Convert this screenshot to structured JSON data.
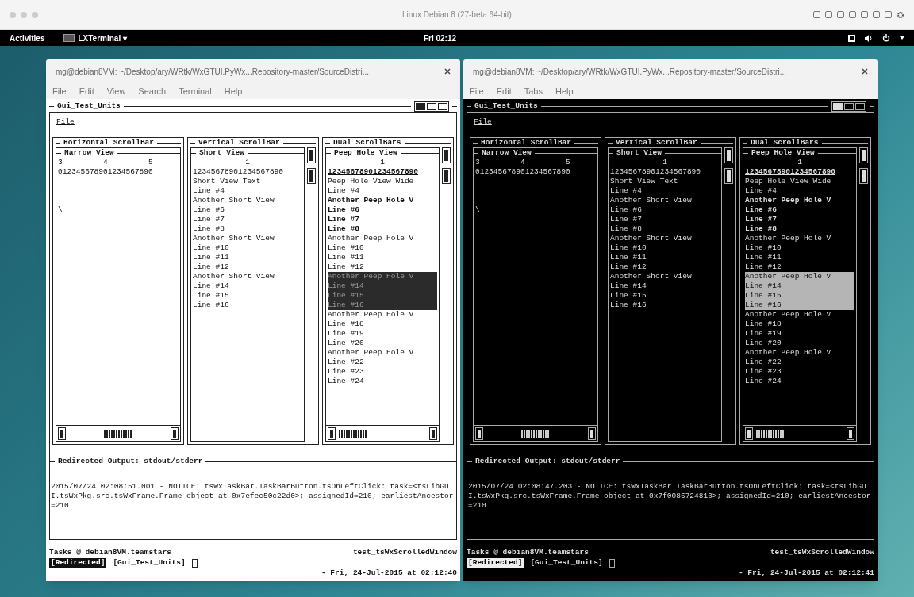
{
  "host_window": {
    "title": "Linux Debian 8 (27-beta 64-bit)"
  },
  "top_bar": {
    "activities": "Activities",
    "app": "LXTerminal ▾",
    "clock": "Fri 02:12"
  },
  "terminals": [
    {
      "kind": "light",
      "title": "mg@debian8VM: ~/Desktop/ary/WRtk/WxGTUI.PyWx...Repository-master/SourceDistri...",
      "menu": [
        "File",
        "Edit",
        "View",
        "Search",
        "Terminal",
        "Help"
      ],
      "app": {
        "title": "Gui_Test_Units",
        "menu": "File",
        "panels": [
          {
            "kind": "horizontal",
            "title": "Horizontal ScrollBar",
            "view_title": "Narrow View",
            "lines": [
              "3         4         5",
              "012345678901234567890"
            ],
            "marker": "\\"
          },
          {
            "kind": "vertical",
            "title": "Vertical ScrollBar",
            "view_title": "Short View",
            "ruler": "1",
            "lines": [
              "12345678901234567890",
              "Short View Text",
              "Line #4",
              "Another Short View",
              "Line #6",
              "Line #7",
              "Line #8",
              "Another Short View",
              "Line #10",
              "Line #11",
              "Line #12",
              "Another Short View",
              "Line #14",
              "Line #15",
              "Line #16"
            ]
          },
          {
            "kind": "dual",
            "title": "Dual ScrollBars",
            "view_title": "Peep Hole View",
            "ruler": "1",
            "lines": [
              {
                "text": "12345678901234567890",
                "bold": true,
                "selected": false
              },
              {
                "text": "Peep Hole View Wide",
                "bold": false,
                "selected": false
              },
              {
                "text": "Line #4",
                "bold": false,
                "selected": false
              },
              {
                "text": "Another Peep Hole V",
                "bold": true,
                "selected": false
              },
              {
                "text": "Line #6",
                "bold": true,
                "selected": false
              },
              {
                "text": "Line #7",
                "bold": true,
                "selected": false
              },
              {
                "text": "Line #8",
                "bold": true,
                "selected": false
              },
              {
                "text": "Another Peep Hole V",
                "bold": false,
                "selected": false
              },
              {
                "text": "Line #10",
                "bold": false,
                "selected": false
              },
              {
                "text": "Line #11",
                "bold": false,
                "selected": false
              },
              {
                "text": "Line #12",
                "bold": false,
                "selected": false
              },
              {
                "text": "Another Peep Hole V",
                "bold": false,
                "selected": true
              },
              {
                "text": "Line #14",
                "bold": false,
                "selected": true
              },
              {
                "text": "Line #15",
                "bold": false,
                "selected": true
              },
              {
                "text": "Line #16",
                "bold": false,
                "selected": true
              },
              {
                "text": "Another Peep Hole V",
                "bold": false,
                "selected": false
              },
              {
                "text": "Line #18",
                "bold": false,
                "selected": false
              },
              {
                "text": "Line #19",
                "bold": false,
                "selected": false
              },
              {
                "text": "Line #20",
                "bold": false,
                "selected": false
              },
              {
                "text": "Another Peep Hole V",
                "bold": false,
                "selected": false
              },
              {
                "text": "Line #22",
                "bold": false,
                "selected": false
              },
              {
                "text": "Line #23",
                "bold": false,
                "selected": false
              },
              {
                "text": "Line #24",
                "bold": false,
                "selected": false
              }
            ]
          }
        ]
      },
      "output": {
        "title": "Redirected Output: stdout/stderr",
        "log": "2015/07/24 02:08:51.001 - NOTICE: tsWxTaskBar.TaskBarButton.tsOnLeftClick: task=<tsLibGUI.tsWxPkg.src.tsWxFrame.Frame object at 0x7efec50c22d0>; assignedId=210; earliestAncestor=210"
      },
      "taskbar": {
        "title": "Tasks @ debian8VM.teamstars",
        "app_name": "test_tsWxScrolledWindow",
        "buttons": [
          {
            "label": "[Redirected]",
            "selected": true
          },
          {
            "label": "[Gui_Test_Units]",
            "selected": false
          }
        ],
        "date": "- Fri, 24-Jul-2015 at 02:12:40"
      }
    },
    {
      "kind": "dark",
      "title": "mg@debian8VM: ~/Desktop/ary/WRtk/WxGTUI.PyWx...Repository-master/SourceDistri...",
      "menu": [
        "File",
        "Edit",
        "Tabs",
        "Help"
      ],
      "app": {
        "title": "Gui_Test_Units",
        "menu": "File",
        "panels": [
          {
            "kind": "horizontal",
            "title": "Horizontal ScrollBar",
            "view_title": "Narrow View",
            "lines": [
              "3         4         5",
              "012345678901234567890"
            ],
            "marker": "\\"
          },
          {
            "kind": "vertical",
            "title": "Vertical ScrollBar",
            "view_title": "Short View",
            "ruler": "1",
            "lines": [
              "12345678901234567890",
              "Short View Text",
              "Line #4",
              "Another Short View",
              "Line #6",
              "Line #7",
              "Line #8",
              "Another Short View",
              "Line #10",
              "Line #11",
              "Line #12",
              "Another Short View",
              "Line #14",
              "Line #15",
              "Line #16"
            ]
          },
          {
            "kind": "dual",
            "title": "Dual ScrollBars",
            "view_title": "Peep Hole View",
            "ruler": "1",
            "lines": [
              {
                "text": "12345678901234567890",
                "bold": true,
                "selected": false
              },
              {
                "text": "Peep Hole View Wide",
                "bold": false,
                "selected": false
              },
              {
                "text": "Line #4",
                "bold": false,
                "selected": false
              },
              {
                "text": "Another Peep Hole V",
                "bold": true,
                "selected": false
              },
              {
                "text": "Line #6",
                "bold": true,
                "selected": false
              },
              {
                "text": "Line #7",
                "bold": true,
                "selected": false
              },
              {
                "text": "Line #8",
                "bold": true,
                "selected": false
              },
              {
                "text": "Another Peep Hole V",
                "bold": false,
                "selected": false
              },
              {
                "text": "Line #10",
                "bold": false,
                "selected": false
              },
              {
                "text": "Line #11",
                "bold": false,
                "selected": false
              },
              {
                "text": "Line #12",
                "bold": false,
                "selected": false
              },
              {
                "text": "Another Peep Hole V",
                "bold": false,
                "selected": true
              },
              {
                "text": "Line #14",
                "bold": false,
                "selected": true
              },
              {
                "text": "Line #15",
                "bold": false,
                "selected": true
              },
              {
                "text": "Line #16",
                "bold": false,
                "selected": true
              },
              {
                "text": "Another Peep Hole V",
                "bold": false,
                "selected": false
              },
              {
                "text": "Line #18",
                "bold": false,
                "selected": false
              },
              {
                "text": "Line #19",
                "bold": false,
                "selected": false
              },
              {
                "text": "Line #20",
                "bold": false,
                "selected": false
              },
              {
                "text": "Another Peep Hole V",
                "bold": false,
                "selected": false
              },
              {
                "text": "Line #22",
                "bold": false,
                "selected": false
              },
              {
                "text": "Line #23",
                "bold": false,
                "selected": false
              },
              {
                "text": "Line #24",
                "bold": false,
                "selected": false
              }
            ]
          }
        ]
      },
      "output": {
        "title": "Redirected Output: stdout/stderr",
        "log": "2015/07/24 02:08:47.203 - NOTICE: tsWxTaskBar.TaskBarButton.tsOnLeftClick: task=<tsLibGUI.tsWxPkg.src.tsWxFrame.Frame object at 0x7f0085724810>; assignedId=210; earliestAncestor=210"
      },
      "taskbar": {
        "title": "Tasks @ debian8VM.teamstars",
        "app_name": "test_tsWxScrolledWindow",
        "buttons": [
          {
            "label": "[Redirected]",
            "selected": true
          },
          {
            "label": "[Gui_Test_Units]",
            "selected": false
          }
        ],
        "date": "- Fri, 24-Jul-2015 at 02:12:41"
      }
    }
  ]
}
